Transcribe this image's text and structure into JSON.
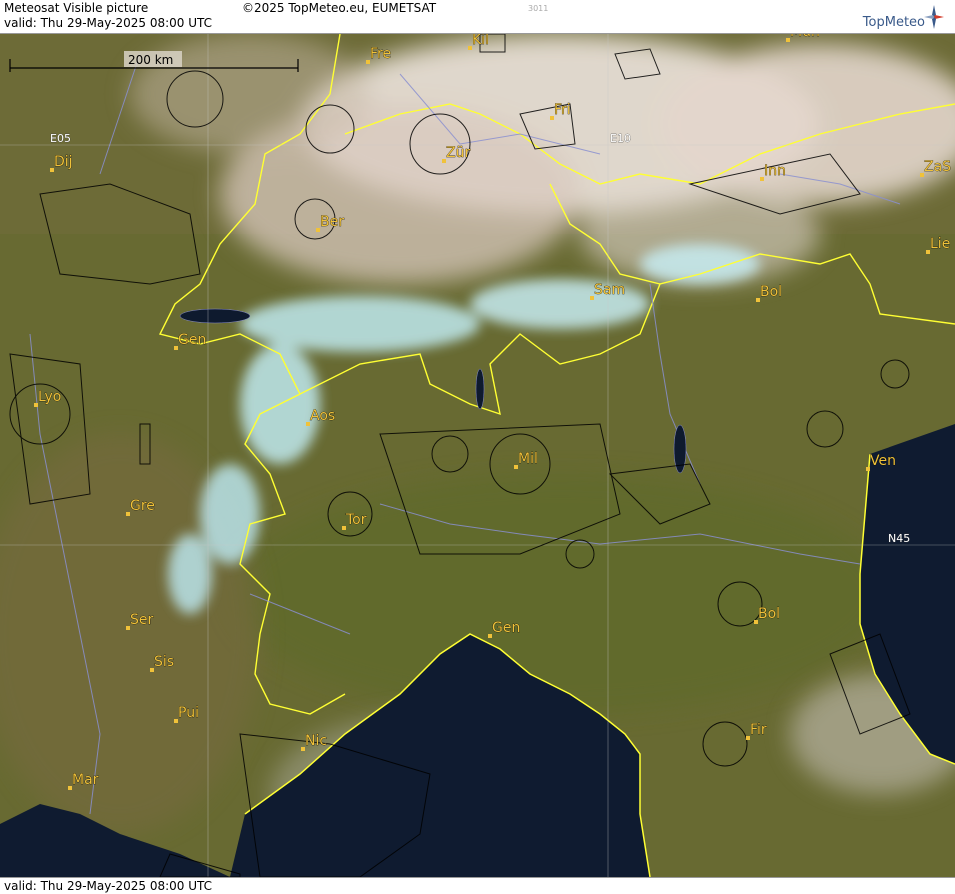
{
  "header": {
    "title": "Meteosat Visible picture",
    "copyright": "©2025 TopMeteo.eu, EUMETSAT",
    "image_id": "3011",
    "valid": "valid:  Thu  29-May-2025  08:00 UTC",
    "logo_text": "TopMeteo"
  },
  "scale_bar": {
    "label": "200 km"
  },
  "grid_labels": {
    "e05": "E05",
    "e10": "E10",
    "n45": "N45"
  },
  "cities": [
    {
      "name": "Kil"
    },
    {
      "name": "Mün"
    },
    {
      "name": "Fre"
    },
    {
      "name": "Fri"
    },
    {
      "name": "Dij"
    },
    {
      "name": "Zür"
    },
    {
      "name": "Inn"
    },
    {
      "name": "ZaS"
    },
    {
      "name": "Ber"
    },
    {
      "name": "Lie"
    },
    {
      "name": "Sam"
    },
    {
      "name": "Bol"
    },
    {
      "name": "Gen"
    },
    {
      "name": "Lyo"
    },
    {
      "name": "Aos"
    },
    {
      "name": "Mil"
    },
    {
      "name": "Ven"
    },
    {
      "name": "Gre"
    },
    {
      "name": "Tor"
    },
    {
      "name": "Ser"
    },
    {
      "name": "Gen"
    },
    {
      "name": "Bol"
    },
    {
      "name": "Sis"
    },
    {
      "name": "Pui"
    },
    {
      "name": "Nic"
    },
    {
      "name": "Fir"
    },
    {
      "name": "Mar"
    }
  ],
  "footer": {
    "valid": "valid:  Thu  29-May-2025  08:00 UTC"
  },
  "colors": {
    "land": "#6b6a35",
    "sea": "#0e1a2e",
    "cloud": "#e8e2dc",
    "snow": "#c9eef4",
    "border": "#ffff33",
    "airspace": "#000000",
    "river": "#8a8fd0",
    "city_label": "#f0c23a"
  }
}
